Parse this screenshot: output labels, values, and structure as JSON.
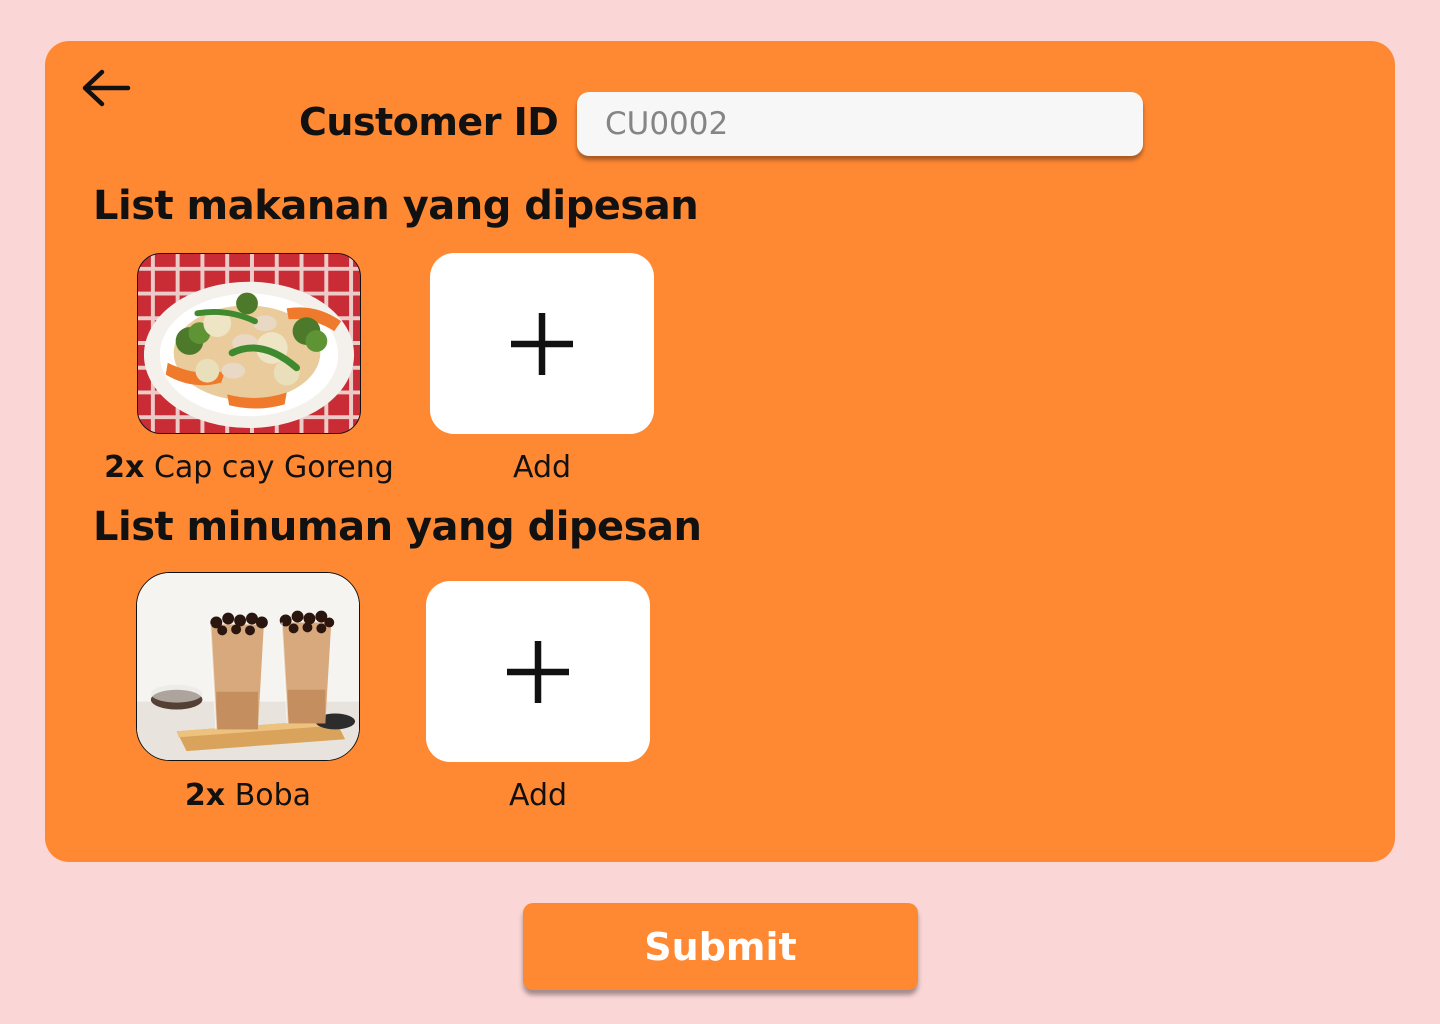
{
  "header": {
    "back_icon": "arrow-left-icon",
    "customer_label": "Customer ID",
    "customer_id_value": "CU0002"
  },
  "food_section": {
    "title": "List makanan yang dipesan",
    "items": [
      {
        "quantity": "2x",
        "name": "Cap cay Goreng",
        "image": "cap-cay-goreng-photo"
      }
    ],
    "add_label": "Add",
    "add_icon": "plus-icon"
  },
  "drink_section": {
    "title": "List minuman yang dipesan",
    "items": [
      {
        "quantity": "2x",
        "name": "Boba",
        "image": "boba-drink-photo"
      }
    ],
    "add_label": "Add",
    "add_icon": "plus-icon"
  },
  "submit_label": "Submit",
  "colors": {
    "background": "#FAD6D6",
    "card": "#FF8833",
    "tile": "#FFFFFF",
    "input": "#F7F7F7",
    "text": "#111111"
  }
}
